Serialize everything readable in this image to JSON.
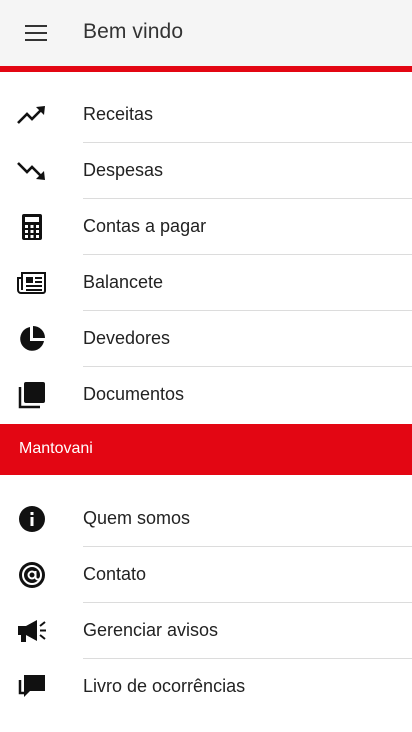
{
  "header": {
    "title": "Bem vindo",
    "menu_icon": "hamburger-menu-icon"
  },
  "colors": {
    "accent": "#e30613",
    "appbar_bg": "#f5f5f5",
    "divider": "#dcdcdc"
  },
  "menu": {
    "items": [
      {
        "label": "Receitas",
        "icon": "trending-up-icon"
      },
      {
        "label": "Despesas",
        "icon": "trending-down-icon"
      },
      {
        "label": "Contas a pagar",
        "icon": "calculator-icon"
      },
      {
        "label": "Balancete",
        "icon": "newspaper-icon"
      },
      {
        "label": "Devedores",
        "icon": "pie-chart-icon"
      },
      {
        "label": "Documentos",
        "icon": "documents-icon"
      }
    ]
  },
  "section": {
    "title": "Mantovani",
    "items": [
      {
        "label": "Quem somos",
        "icon": "info-icon"
      },
      {
        "label": "Contato",
        "icon": "at-sign-icon"
      },
      {
        "label": "Gerenciar avisos",
        "icon": "megaphone-icon"
      },
      {
        "label": "Livro de ocorrências",
        "icon": "chat-bubbles-icon"
      }
    ]
  }
}
